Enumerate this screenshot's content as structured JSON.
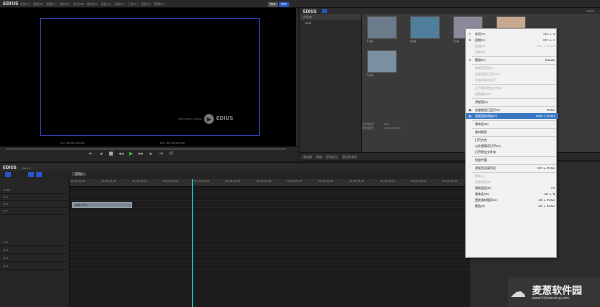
{
  "app": {
    "logo": "EDIUS",
    "menu": [
      "文件(F)",
      "编辑(E)",
      "视图(V)",
      "素材(C)",
      "标记(M)",
      "模式(O)",
      "采集(A)",
      "渲染(R)",
      "工具(T)",
      "设置(S)",
      "帮助(H)"
    ],
    "badges": {
      "plr": "PLR",
      "rec": "REC"
    }
  },
  "player": {
    "watermark_text": "EDIUS",
    "watermark_sub": "PREVIEW USING",
    "timecode_in": "Cur 00:00:00;00",
    "timecode_out": "Dur 00:00:00;00"
  },
  "transport": {
    "buttons": [
      "⇤",
      "◂",
      "■",
      "◂◂",
      "▶",
      "▸▸",
      "▸",
      "⇥",
      "↺"
    ]
  },
  "bin": {
    "title": "EDIUS",
    "folder_label": "文件夹",
    "folder_root": "root",
    "zoom": "100%",
    "thumbs": [
      {
        "caption": "1.jpg",
        "color": "#6b7b8c"
      },
      {
        "caption": "2.jpg",
        "color": "#4f7f9a"
      },
      {
        "caption": "3.jpg",
        "color": "#8a8a9a"
      },
      {
        "caption": "4.jpg",
        "color": "#c7a98f"
      },
      {
        "caption": "5.jpg",
        "color": "#7a8f9f"
      }
    ],
    "props": [
      {
        "k": "文件格式",
        "v": "JPG"
      },
      {
        "k": "视频格式",
        "v": "1920x1080"
      }
    ]
  },
  "proptabs": [
    "素材库",
    "特效",
    "序列标记",
    "源文件浏览"
  ],
  "timeline": {
    "title": "EDIUS",
    "seq": "Seq 1",
    "tab": "序列1",
    "ruler": [
      "00:00:00;00",
      "00:00:04;00",
      "00:00:08;00",
      "00:00:12;00",
      "00:00:16;00",
      "00:00:20;00",
      "00:00:24;00",
      "00:00:28;00",
      "00:00:32;00",
      "00:00:36;00",
      "00:00:40;00",
      "00:00:44;00",
      "00:00:48;00"
    ],
    "tracks": [
      "1 VA",
      "2 V",
      "3 V",
      "1 T",
      "1 A",
      "2 A",
      "3 A",
      "4 A"
    ],
    "clip_label": "素材 1 [V]"
  },
  "context_menu": {
    "items": [
      {
        "label": "剪切(T)",
        "shortcut": "Ctrl + X",
        "icon": "✂",
        "disabled": false
      },
      {
        "label": "复制(C)",
        "shortcut": "Ctrl + C",
        "icon": "⧉",
        "disabled": false
      },
      {
        "label": "粘贴(P)",
        "shortcut": "Ctrl + Insert",
        "icon": "",
        "disabled": true
      },
      {
        "label": "替换(R)",
        "shortcut": "",
        "icon": "",
        "disabled": true
      },
      {
        "label": "",
        "sep": true
      },
      {
        "label": "删除(D)",
        "shortcut": "Delete",
        "icon": "✕",
        "disabled": false
      },
      {
        "label": "",
        "sep": true
      },
      {
        "label": "添加到序列(A)",
        "shortcut": "",
        "icon": "",
        "disabled": true
      },
      {
        "label": "在播放窗口显示(S)",
        "shortcut": "",
        "icon": "",
        "disabled": true
      },
      {
        "label": "在素材库中显示",
        "shortcut": "",
        "icon": "",
        "disabled": true
      },
      {
        "label": "",
        "sep": true
      },
      {
        "label": "打开素材所在文件夹",
        "shortcut": "",
        "icon": "",
        "disabled": true
      },
      {
        "label": "编辑素材(E)",
        "shortcut": "",
        "icon": "",
        "disabled": true
      },
      {
        "label": "",
        "sep": true
      },
      {
        "label": "添加到(A)",
        "shortcut": "",
        "icon": "",
        "disabled": false
      },
      {
        "label": "",
        "sep": true
      },
      {
        "label": "在播放窗口显示(V)",
        "shortcut": "Enter",
        "icon": "▣",
        "disabled": false
      },
      {
        "label": "添加到时间线(T)",
        "shortcut": "Shift + Enter",
        "icon": "▤",
        "highlight": true,
        "disabled": false
      },
      {
        "label": "",
        "sep": true
      },
      {
        "label": "重命名(N)",
        "shortcut": "",
        "icon": "",
        "disabled": false
      },
      {
        "label": "",
        "sep": true
      },
      {
        "label": "素材颜色",
        "shortcut": "",
        "icon": "",
        "disabled": false
      },
      {
        "label": "",
        "sep": true
      },
      {
        "label": "打开方式",
        "shortcut": "",
        "icon": "",
        "disabled": false
      },
      {
        "label": "以外部程序打开(O)",
        "shortcut": "",
        "icon": "",
        "disabled": false
      },
      {
        "label": "打开所在文件夹",
        "shortcut": "",
        "icon": "",
        "disabled": false
      },
      {
        "label": "",
        "sep": true
      },
      {
        "label": "创建代理",
        "shortcut": "",
        "icon": "",
        "disabled": false
      },
      {
        "label": "",
        "sep": true
      },
      {
        "label": "添加到渲染列表",
        "shortcut": "Ctrl + Enter",
        "icon": "",
        "disabled": false
      },
      {
        "label": "",
        "sep": true
      },
      {
        "label": "刷新(L)",
        "shortcut": "",
        "icon": "",
        "disabled": true
      },
      {
        "label": "完整替换(P)",
        "shortcut": "",
        "icon": "",
        "disabled": true
      },
      {
        "label": "重新链接(R)",
        "shortcut": "F2",
        "icon": "",
        "disabled": false
      },
      {
        "label": "重命名(M)",
        "shortcut": "Alt + N",
        "icon": "",
        "disabled": false
      },
      {
        "label": "更新素材缓存(U)",
        "shortcut": "Alt + Enter",
        "icon": "",
        "disabled": false
      },
      {
        "label": "属性(P)",
        "shortcut": "Alt + Enter",
        "icon": "",
        "disabled": false
      }
    ]
  },
  "watermark": {
    "title": "麦葱软件园",
    "url": "www.52maicong.com"
  }
}
